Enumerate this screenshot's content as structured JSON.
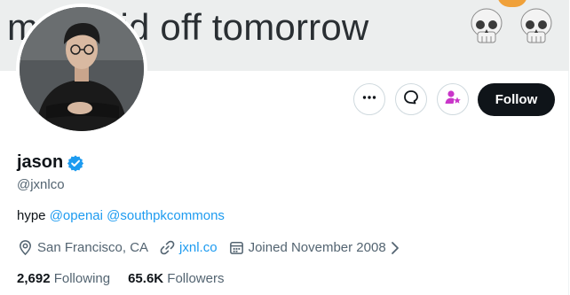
{
  "banner": {
    "top_partial_text": "m  g        t   p",
    "text": "m     et laid off tomorrow",
    "emoji_icons": [
      "skull-icon",
      "skull-icon"
    ]
  },
  "profile": {
    "display_name": "jason",
    "verified_icon": "verified-badge-icon",
    "handle": "@jxnlco",
    "bio": {
      "prefix": "hype ",
      "mention_1": "@openai",
      "separator": " ",
      "mention_2": "@southpkcommons"
    },
    "location": "San Francisco, CA",
    "website": "jxnl.co",
    "joined": "Joined November 2008",
    "following_count": "2,692",
    "following_label": "Following",
    "followers_count": "65.6K",
    "followers_label": "Followers"
  },
  "actions": {
    "more_icon": "more-horizontal-icon",
    "message_icon": "message-bubble-icon",
    "subscribe_icon": "person-star-icon",
    "follow_label": "Follow"
  },
  "colors": {
    "accent": "#1d9bf0",
    "subscribe": "#c936c9",
    "follow_bg": "#0f1419",
    "muted": "#536471"
  }
}
